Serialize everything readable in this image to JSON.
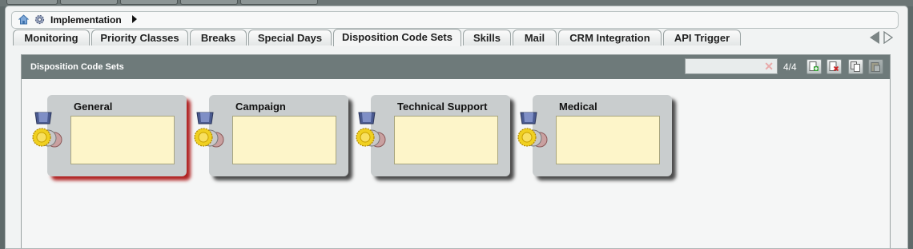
{
  "breadcrumb": {
    "label": "Implementation"
  },
  "tabs": [
    {
      "label": "Monitoring"
    },
    {
      "label": "Priority Classes"
    },
    {
      "label": "Breaks"
    },
    {
      "label": "Special Days"
    },
    {
      "label": "Disposition Code Sets"
    },
    {
      "label": "Skills"
    },
    {
      "label": "Mail"
    },
    {
      "label": "CRM Integration"
    },
    {
      "label": "API Trigger"
    }
  ],
  "active_tab": "Disposition Code Sets",
  "panel": {
    "title": "Disposition Code Sets",
    "search": {
      "value": "",
      "clear_icon": "close-icon"
    },
    "count": "4/4",
    "toolbar": [
      "add-icon",
      "delete-icon",
      "copy-icon",
      "paste-icon"
    ]
  },
  "cards": [
    {
      "title": "General",
      "selected": true
    },
    {
      "title": "Campaign",
      "selected": false
    },
    {
      "title": "Technical Support",
      "selected": false
    },
    {
      "title": "Medical",
      "selected": false
    }
  ],
  "colors": {
    "header": "#6e7a7a",
    "card_body": "#fdf5c9",
    "selection_shadow": "#b02323"
  }
}
